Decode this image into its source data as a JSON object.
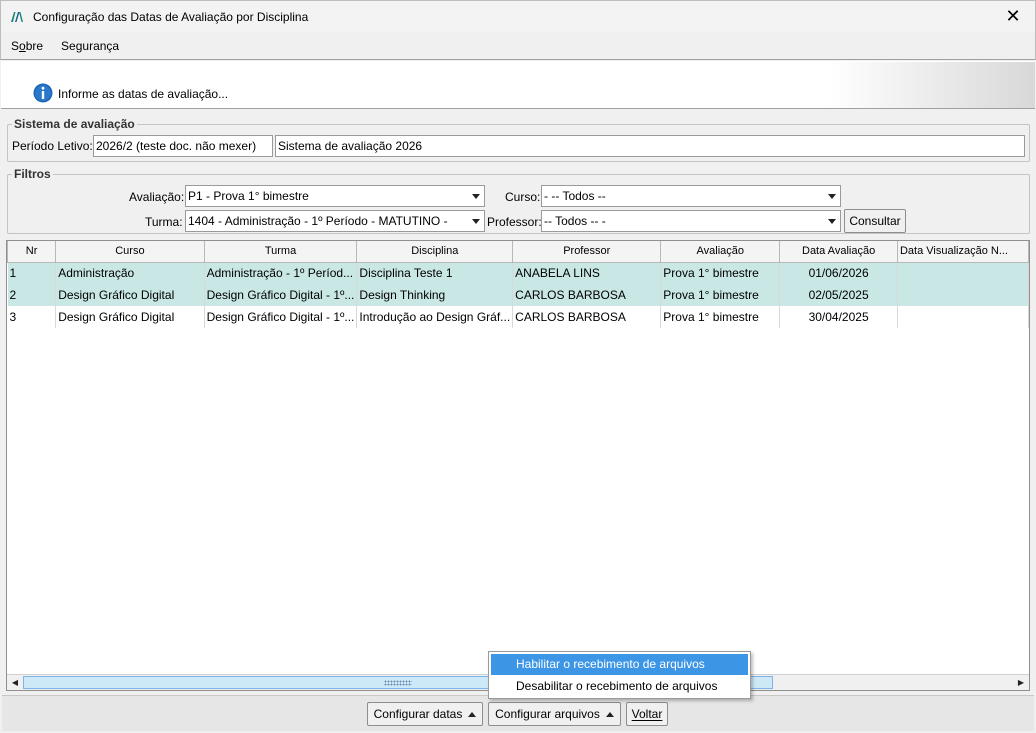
{
  "window": {
    "title": "Configuração das Datas de Avaliação por Disciplina",
    "close_glyph": "✕"
  },
  "menu": {
    "items": [
      {
        "label_prefix": "S",
        "label_underline": "o",
        "label_rest": "bre"
      },
      {
        "label_prefix": "",
        "label_underline": "",
        "label_rest": "Segurança"
      }
    ]
  },
  "info": {
    "icon": "info-icon",
    "text": "Informe as datas de avaliação..."
  },
  "sistema": {
    "legend": "Sistema de avaliação",
    "periodo_label": "Período Letivo:",
    "periodo_value": "2026/2 (teste doc. não mexer)",
    "sistema_value": "Sistema de avaliação 2026"
  },
  "filtros": {
    "legend": "Filtros",
    "avaliacao_label": "Avaliação:",
    "avaliacao_value": "P1 - Prova 1° bimestre",
    "curso_label": "Curso:",
    "curso_value": "- -- Todos --",
    "turma_label": "Turma:",
    "turma_value": "1404 - Administração - 1º Período - MATUTINO -",
    "professor_label": "Professor:",
    "professor_value": "-- Todos -- -",
    "consultar_label": "Consultar"
  },
  "grid": {
    "columns": [
      "Nr",
      "Curso",
      "Turma",
      "Disciplina",
      "Professor",
      "Avaliação",
      "Data Avaliação",
      "Data Visualização N..."
    ],
    "rows": [
      {
        "nr": "1",
        "curso": "Administração",
        "turma": "Administração - 1º Períod...",
        "disciplina": "Disciplina Teste 1",
        "professor": "ANABELA LINS",
        "avaliacao": "Prova 1° bimestre",
        "data": "01/06/2026",
        "vis": "",
        "selected": true
      },
      {
        "nr": "2",
        "curso": "Design Gráfico Digital",
        "turma": "Design Gráfico Digital - 1º...",
        "disciplina": "Design Thinking",
        "professor": "CARLOS BARBOSA",
        "avaliacao": "Prova 1° bimestre",
        "data": "02/05/2025",
        "vis": "",
        "selected": true
      },
      {
        "nr": "3",
        "curso": "Design Gráfico Digital",
        "turma": "Design Gráfico Digital - 1º...",
        "disciplina": "Introdução ao Design Gráf...",
        "professor": "CARLOS BARBOSA",
        "avaliacao": "Prova 1° bimestre",
        "data": "30/04/2025",
        "vis": "",
        "selected": false
      }
    ]
  },
  "scrollbar": {
    "left_glyph": "◀",
    "right_glyph": "▶"
  },
  "buttons": {
    "configurar_datas": "Configurar datas",
    "configurar_arquivos": "Configurar arquivos",
    "voltar": "Voltar"
  },
  "popup": {
    "items": [
      "Habilitar o recebimento de arquivos",
      "Desabilitar o recebimento de arquivos"
    ]
  },
  "colors": {
    "selected_row": "#c8e7e5",
    "menu_highlight": "#3d95e6",
    "info_icon": "#1e64b4"
  }
}
